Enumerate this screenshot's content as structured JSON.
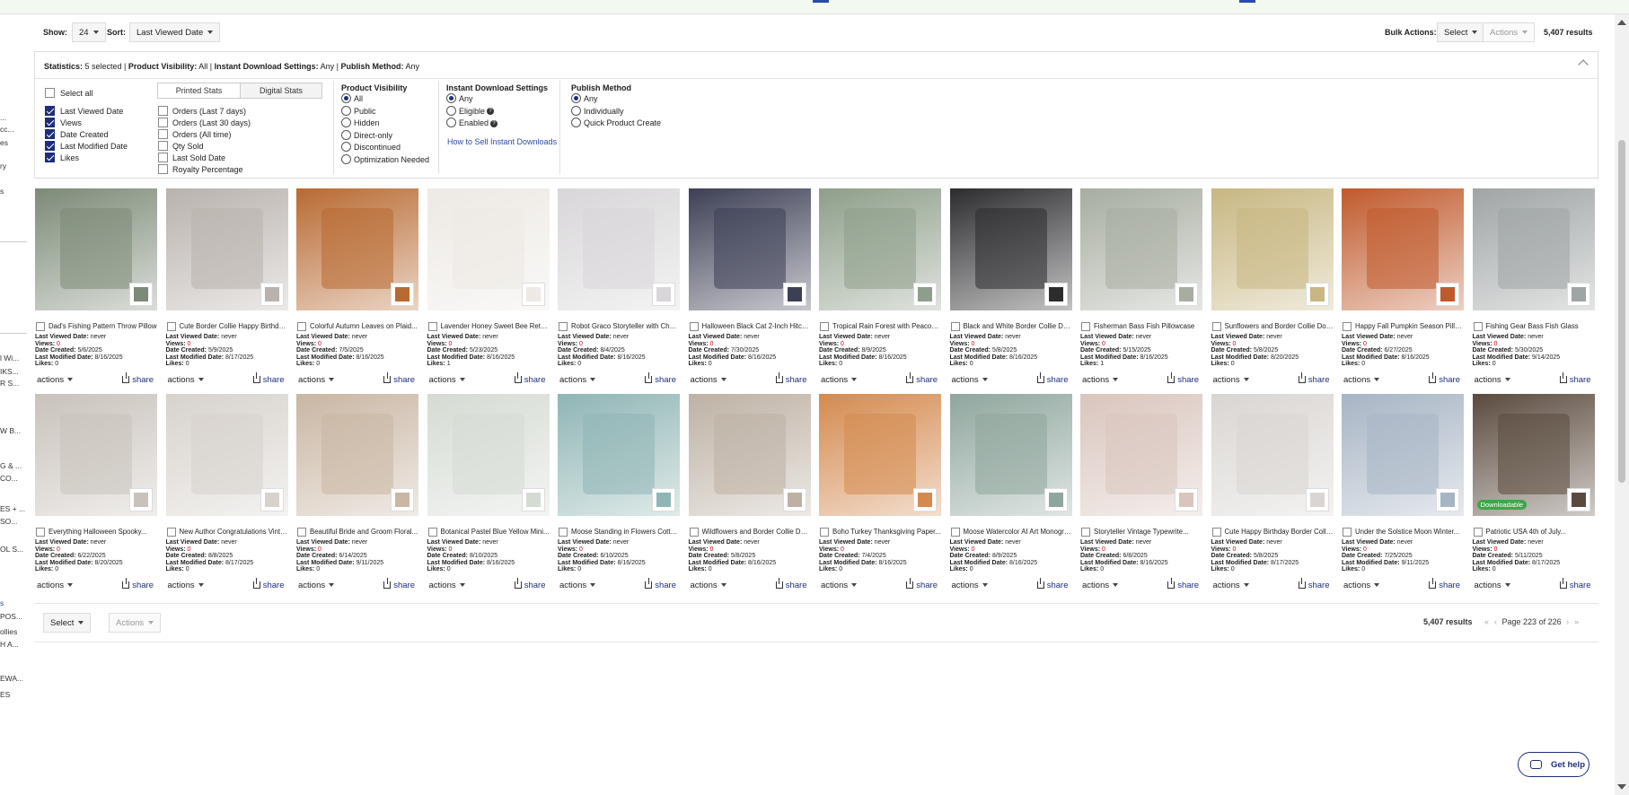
{
  "left_sidebar": {
    "items": [
      "...",
      "cc...",
      "es",
      "ry",
      "s",
      "l Wi...",
      "IKS...",
      "R S...",
      "W B...",
      "G & ...",
      "CO...",
      "ES + ...",
      "SO...",
      "OL S...",
      "s",
      "POS...",
      "ollies",
      "H A...",
      "EWA...",
      "ES"
    ]
  },
  "toolbar": {
    "show_label": "Show:",
    "show_value": "24",
    "sort_label": "Sort:",
    "sort_value": "Last Viewed Date",
    "bulk_label": "Bulk Actions:",
    "bulk_select": "Select",
    "bulk_actions": "Actions",
    "results": "5,407 results"
  },
  "stats": {
    "summary_label": "Statistics:",
    "summary_text": "5 selected | ",
    "visibility_label": "Product Visibility:",
    "visibility_text": "All | ",
    "instant_label": "Instant Download Settings:",
    "instant_text": "Any | ",
    "publish_label": "Publish Method:",
    "publish_text": "Any",
    "select_all": "Select all",
    "tabs": [
      "Printed Stats",
      "Digital Stats"
    ],
    "checkboxes_left": [
      {
        "label": "Last Viewed Date",
        "checked": true
      },
      {
        "label": "Views",
        "checked": true
      },
      {
        "label": "Date Created",
        "checked": true
      },
      {
        "label": "Last Modified Date",
        "checked": true
      },
      {
        "label": "Likes",
        "checked": true
      }
    ],
    "checkboxes_right": [
      {
        "label": "Orders (Last 7 days)",
        "checked": false
      },
      {
        "label": "Orders (Last 30 days)",
        "checked": false
      },
      {
        "label": "Orders (All time)",
        "checked": false
      },
      {
        "label": "Qty Sold",
        "checked": false
      },
      {
        "label": "Last Sold Date",
        "checked": false
      },
      {
        "label": "Royalty Percentage",
        "checked": false
      }
    ],
    "visibility_title": "Product Visibility",
    "visibility_options": [
      {
        "label": "All",
        "selected": true
      },
      {
        "label": "Public",
        "selected": false
      },
      {
        "label": "Hidden",
        "selected": false
      },
      {
        "label": "Direct-only",
        "selected": false
      },
      {
        "label": "Discontinued",
        "selected": false
      },
      {
        "label": "Optimization Needed",
        "selected": false
      }
    ],
    "instant_title": "Instant Download Settings",
    "instant_options": [
      {
        "label": "Any",
        "selected": true
      },
      {
        "label": "Eligible",
        "selected": false
      },
      {
        "label": "Enabled",
        "selected": false
      }
    ],
    "instant_link": "How to Sell Instant Downloads",
    "publish_title": "Publish Method",
    "publish_options": [
      {
        "label": "Any",
        "selected": true
      },
      {
        "label": "Individually",
        "selected": false
      },
      {
        "label": "Quick Product Create",
        "selected": false
      }
    ]
  },
  "labels": {
    "last_viewed": "Last Viewed Date:",
    "views": "Views:",
    "created": "Date Created:",
    "modified": "Last Modified Date:",
    "likes": "Likes:",
    "actions": "actions",
    "share": "share",
    "downloadable": "Downloadable"
  },
  "products": [
    {
      "title": "Dad's Fishing Pattern Throw Pillow",
      "viewed": "never",
      "views": "0",
      "created": "5/6/2025",
      "modified": "8/16/2025",
      "likes": "0",
      "color": "#7c8a77"
    },
    {
      "title": "Cute Border Collie Happy Birthday...",
      "viewed": "never",
      "views": "0",
      "created": "5/9/2025",
      "modified": "8/17/2025",
      "likes": "0",
      "color": "#b9b2ad"
    },
    {
      "title": "Colorful Autumn Leaves on Plaid...",
      "viewed": "never",
      "views": "0",
      "created": "7/5/2025",
      "modified": "8/16/2025",
      "likes": "0",
      "color": "#b86a32"
    },
    {
      "title": "Lavender Honey Sweet Bee Return...",
      "viewed": "never",
      "views": "0",
      "created": "5/23/2025",
      "modified": "8/16/2025",
      "likes": "1",
      "color": "#ede9e4"
    },
    {
      "title": "Robot Graco Storyteller with Charm...",
      "viewed": "never",
      "views": "0",
      "created": "8/4/2025",
      "modified": "8/16/2025",
      "likes": "0",
      "color": "#d8d6d8"
    },
    {
      "title": "Halloween Black Cat 2-Inch Hitch...",
      "viewed": "never",
      "views": "0",
      "created": "7/30/2025",
      "modified": "8/16/2025",
      "likes": "0",
      "color": "#3d4055"
    },
    {
      "title": "Tropical Rain Forest with Peacocks...",
      "viewed": "never",
      "views": "0",
      "created": "8/9/2025",
      "modified": "8/16/2025",
      "likes": "0",
      "color": "#8e9e8a"
    },
    {
      "title": "Black and White Border Collie Dog...",
      "viewed": "never",
      "views": "0",
      "created": "5/8/2025",
      "modified": "8/16/2025",
      "likes": "0",
      "color": "#2c2c2f"
    },
    {
      "title": "Fisherman Bass Fish Pillowcase",
      "viewed": "never",
      "views": "0",
      "created": "5/15/2025",
      "modified": "8/16/2025",
      "likes": "1",
      "color": "#a7ada0"
    },
    {
      "title": "Sunflowers and Border Collie Dog...",
      "viewed": "never",
      "views": "0",
      "created": "5/8/2025",
      "modified": "8/20/2025",
      "likes": "0",
      "color": "#c8b782"
    },
    {
      "title": "Happy Fall Pumpkin Season Pillar...",
      "viewed": "never",
      "views": "0",
      "created": "6/27/2025",
      "modified": "8/16/2025",
      "likes": "0",
      "color": "#c05a2c"
    },
    {
      "title": "Fishing Gear Bass Fish Glass",
      "viewed": "never",
      "views": "0",
      "created": "5/30/2025",
      "modified": "9/14/2025",
      "likes": "0",
      "color": "#9fa4a4"
    },
    {
      "title": "Everything Halloween Spooky...",
      "viewed": "never",
      "views": "0",
      "created": "6/22/2025",
      "modified": "8/20/2025",
      "likes": "0",
      "color": "#c9c2bb"
    },
    {
      "title": "New Author Congratulations Vinta...",
      "viewed": "never",
      "views": "0",
      "created": "8/8/2025",
      "modified": "8/17/2025",
      "likes": "0",
      "color": "#d7d2cc"
    },
    {
      "title": "Beautiful Bride and Groom Floral...",
      "viewed": "never",
      "views": "0",
      "created": "6/14/2025",
      "modified": "9/11/2025",
      "likes": "0",
      "color": "#c9b6a3"
    },
    {
      "title": "Botanical Pastel Blue Yellow Mini...",
      "viewed": "never",
      "views": "0",
      "created": "8/10/2025",
      "modified": "8/16/2025",
      "likes": "0",
      "color": "#d5dbd3"
    },
    {
      "title": "Moose Standing in Flowers Cotton...",
      "viewed": "never",
      "views": "0",
      "created": "6/10/2025",
      "modified": "8/16/2025",
      "likes": "0",
      "color": "#8fb5b4"
    },
    {
      "title": "Wildflowers and Border Collie Dog...",
      "viewed": "never",
      "views": "0",
      "created": "5/8/2025",
      "modified": "8/16/2025",
      "likes": "0",
      "color": "#bdb1a4"
    },
    {
      "title": "Boho Turkey Thanksgiving Paper...",
      "viewed": "never",
      "views": "0",
      "created": "7/4/2025",
      "modified": "8/16/2025",
      "likes": "0",
      "color": "#d48a4f"
    },
    {
      "title": "Moose Watercolor AI Art Monogra...",
      "viewed": "never",
      "views": "0",
      "created": "8/9/2025",
      "modified": "8/16/2025",
      "likes": "0",
      "color": "#8fa69d"
    },
    {
      "title": "Storyteller Vintage Typewrite...",
      "viewed": "never",
      "views": "0",
      "created": "6/8/2025",
      "modified": "8/16/2025",
      "likes": "0",
      "color": "#d9c5bd"
    },
    {
      "title": "Cute Happy Birthday Border Colle...",
      "viewed": "never",
      "views": "0",
      "created": "5/8/2025",
      "modified": "8/17/2025",
      "likes": "0",
      "color": "#d9d5d2"
    },
    {
      "title": "Under the Solstice Moon Winter...",
      "viewed": "never",
      "views": "0",
      "created": "7/25/2025",
      "modified": "9/11/2025",
      "likes": "0",
      "color": "#a7b4c4"
    },
    {
      "title": "Patriotic USA 4th of July...",
      "viewed": "never",
      "views": "0",
      "created": "5/11/2025",
      "modified": "8/17/2025",
      "likes": "0",
      "color": "#5a4a3e",
      "downloadable": true
    }
  ],
  "footer": {
    "select": "Select",
    "actions": "Actions",
    "results": "5,407 results",
    "page_text": "Page 223 of 226"
  },
  "help": {
    "label": "Get help"
  }
}
